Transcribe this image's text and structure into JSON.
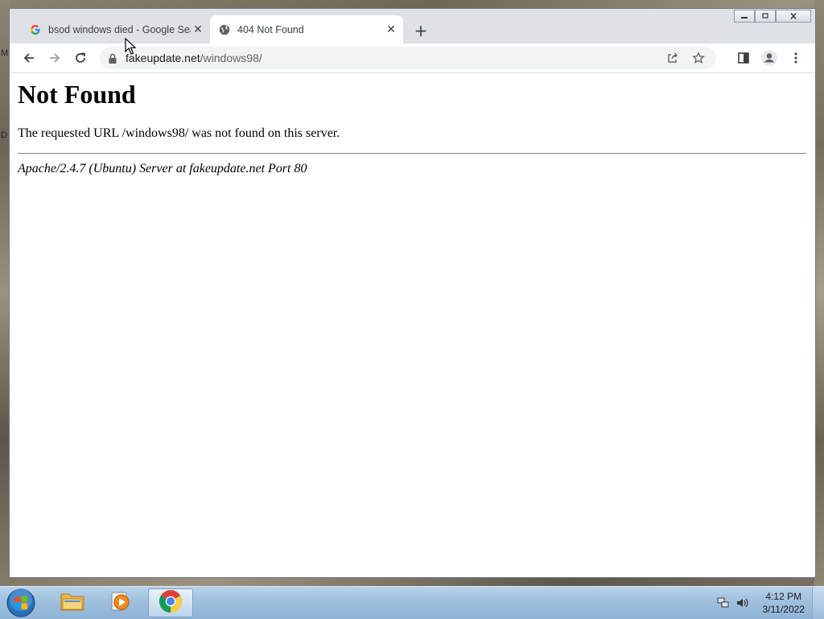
{
  "desktop": {
    "left_letters": [
      "M",
      "D"
    ]
  },
  "browser": {
    "tabs": [
      {
        "title": "bsod windows died - Google Sea",
        "favicon": "google-icon",
        "state": "inactive"
      },
      {
        "title": "404 Not Found",
        "favicon": "globe-icon",
        "state": "active"
      }
    ],
    "new_tab_label": "+",
    "url": {
      "host": "fakeupdate.net",
      "path": "/windows98/"
    }
  },
  "page": {
    "heading": "Not Found",
    "message": "The requested URL /windows98/ was not found on this server.",
    "server_signature": "Apache/2.4.7 (Ubuntu) Server at fakeupdate.net Port 80"
  },
  "taskbar": {
    "apps": [
      {
        "name": "windows-explorer",
        "icon": "folder-icon"
      },
      {
        "name": "media-player",
        "icon": "media-player-icon"
      },
      {
        "name": "google-chrome",
        "icon": "chrome-icon",
        "active": true
      }
    ],
    "clock": {
      "time": "4:12 PM",
      "date": "3/11/2022"
    }
  },
  "colors": {
    "tabstrip": "#dee1e6",
    "omnibox": "#f1f3f4",
    "taskbar": "#9fc0de"
  }
}
